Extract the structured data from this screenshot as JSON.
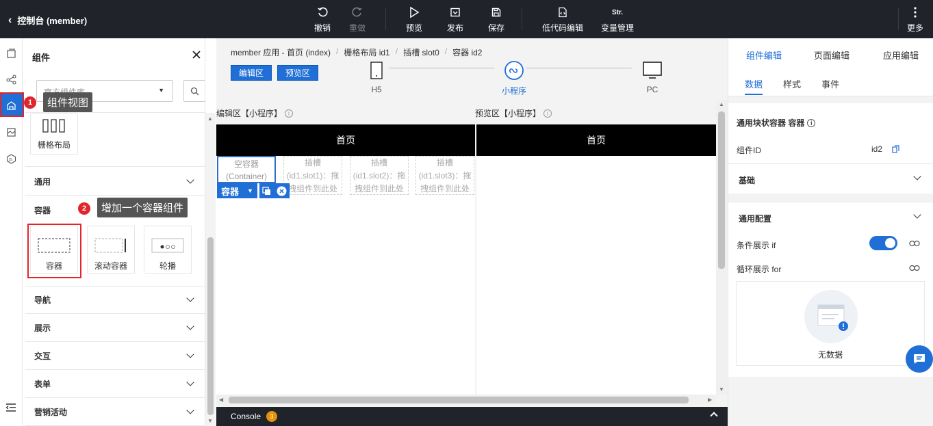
{
  "topbar": {
    "back_label": "控制台 (member)",
    "tools": {
      "undo": "撤销",
      "redo": "重做",
      "preview": "预览",
      "publish": "发布",
      "save": "保存",
      "lowcode": "低代码编辑",
      "variables": "变量管理",
      "variables_icon_text": "Str.",
      "more": "更多"
    }
  },
  "rail": {
    "icons": [
      "pages-icon",
      "tree-icon",
      "components-icon",
      "materials-icon",
      "js-icon",
      "menu-collapse-icon"
    ],
    "active": "components-icon"
  },
  "panel": {
    "title": "组件",
    "library_select": "官方组件库",
    "grid_card_label": "栅格布局",
    "sections": {
      "general": "通用",
      "container": "容器",
      "navigation": "导航",
      "display": "展示",
      "interaction": "交互",
      "form": "表单",
      "marketing": "营销活动"
    },
    "container_cards": [
      "容器",
      "滚动容器",
      "轮播"
    ]
  },
  "callouts": {
    "step1_num": "1",
    "step1_text": "组件视图",
    "step2_num": "2",
    "step2_text": "增加一个容器组件"
  },
  "center": {
    "breadcrumb": [
      "member 应用 - 首页 (index)",
      "栅格布局 id1",
      "插槽 slot0",
      "容器 id2"
    ],
    "edit_btn": "编辑区",
    "preview_btn": "预览区",
    "devices": [
      "H5",
      "小程序",
      "PC"
    ],
    "active_device": "小程序",
    "edit_area_title": "编辑区【小程序】",
    "preview_area_title": "预览区【小程序】",
    "page_title": "首页",
    "empty_container": [
      "空容器",
      "(Container)"
    ],
    "slots": [
      [
        "插槽",
        "(id1.slot1)：拖",
        "拽组件到此处"
      ],
      [
        "插槽",
        "(id1.slot2)：拖",
        "拽组件到此处"
      ],
      [
        "插槽",
        "(id1.slot3)：拖",
        "拽组件到此处"
      ]
    ],
    "selected_toolbar_label": "容器",
    "console_label": "Console",
    "console_count": "3"
  },
  "rpanel": {
    "tabs": [
      "组件编辑",
      "页面编辑",
      "应用编辑"
    ],
    "subtabs": [
      "数据",
      "样式",
      "事件"
    ],
    "component_header": "通用块状容器 容器",
    "id_label": "组件ID",
    "id_value": "id2",
    "basic_section": "基础",
    "general_config": "通用配置",
    "cond_label": "条件展示 if",
    "loop_label": "循环展示 for",
    "cond_enabled": true,
    "empty_text": "无数据"
  },
  "colors": {
    "accent": "#1f6fd6",
    "topbar_bg": "#20232a",
    "highlight_red": "#e0252b"
  }
}
